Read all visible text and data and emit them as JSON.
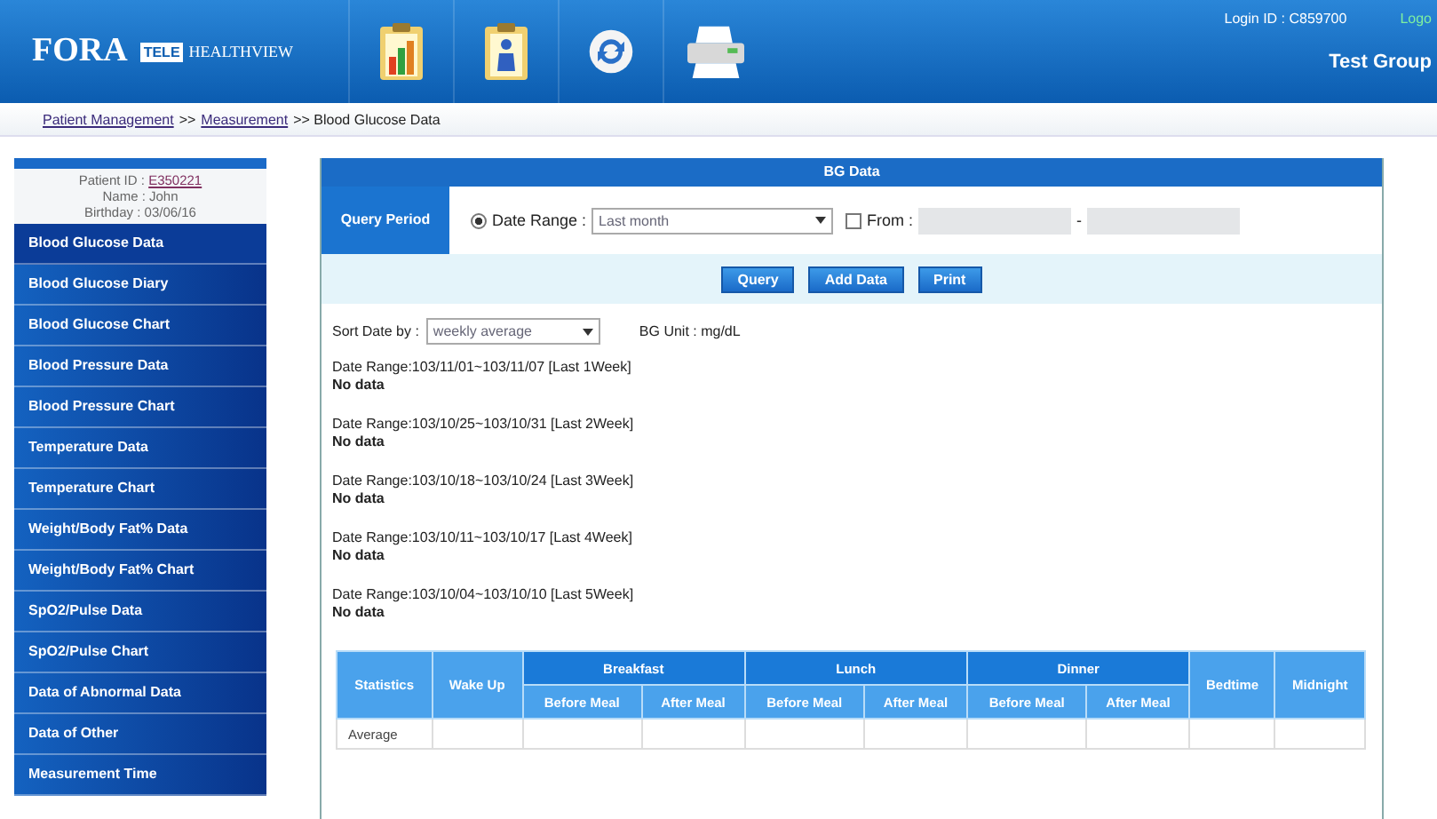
{
  "header": {
    "brand": "FORA",
    "badge": "TELE",
    "product": "HEALTHVIEW",
    "login": "Login ID : C859700",
    "logout": "Logo",
    "group": "Test Group"
  },
  "toolbar": [
    {
      "kind": "chart"
    },
    {
      "kind": "patient"
    },
    {
      "kind": "refresh"
    },
    {
      "kind": "print"
    }
  ],
  "breadcrumb": [
    "Patient Management",
    ">>",
    "Measurement",
    ">> Blood Glucose Data"
  ],
  "patient": {
    "id_label": "Patient ID :",
    "id": "E350221",
    "name": "Name : John",
    "birthday": "Birthday : 03/06/16"
  },
  "sidebar": {
    "items": [
      {
        "label": "Blood Glucose Data",
        "selected": true
      },
      {
        "label": "Blood Glucose Diary",
        "selected": false
      },
      {
        "label": "Blood Glucose Chart",
        "selected": false
      },
      {
        "label": "Blood Pressure Data",
        "selected": false
      },
      {
        "label": "Blood Pressure Chart",
        "selected": false
      },
      {
        "label": "Temperature Data",
        "selected": false
      },
      {
        "label": "Temperature Chart",
        "selected": false
      },
      {
        "label": "Weight/Body Fat% Data",
        "selected": false
      },
      {
        "label": "Weight/Body Fat% Chart",
        "selected": false
      },
      {
        "label": "SpO2/Pulse Data",
        "selected": false
      },
      {
        "label": "SpO2/Pulse Chart",
        "selected": false
      },
      {
        "label": "Data of Abnormal Data",
        "selected": false
      },
      {
        "label": "Data of Other",
        "selected": false
      },
      {
        "label": "Measurement Time",
        "selected": false
      }
    ]
  },
  "panel": {
    "title": "BG Data",
    "query_label": "Query Period",
    "date_range": {
      "label": "Date Range :",
      "selected": true,
      "value": "Last month"
    },
    "from": {
      "label": "From :",
      "checked": false,
      "separator": "-"
    },
    "buttons": [
      "Query",
      "Add Data",
      "Print"
    ],
    "sort": {
      "label": "Sort Date by :",
      "value": "weekly average"
    },
    "unit": "BG Unit : mg/dL",
    "weeks": [
      {
        "range": "Date Range:103/11/01~103/11/07 [Last 1Week]",
        "result": "No data"
      },
      {
        "range": "Date Range:103/10/25~103/10/31 [Last 2Week]",
        "result": "No data"
      },
      {
        "range": "Date Range:103/10/18~103/10/24 [Last 3Week]",
        "result": "No data"
      },
      {
        "range": "Date Range:103/10/11~103/10/17 [Last 4Week]",
        "result": "No data"
      },
      {
        "range": "Date Range:103/10/04~103/10/10 [Last 5Week]",
        "result": "No data"
      }
    ],
    "table": {
      "columns": [
        {
          "label": "Statistics"
        },
        {
          "label": "Wake Up"
        },
        {
          "label": "Breakfast",
          "children": [
            "Before Meal",
            "After Meal"
          ]
        },
        {
          "label": "Lunch",
          "children": [
            "Before Meal",
            "After Meal"
          ]
        },
        {
          "label": "Dinner",
          "children": [
            "Before Meal",
            "After Meal"
          ]
        },
        {
          "label": "Bedtime"
        },
        {
          "label": "Midnight"
        }
      ],
      "rows": [
        [
          "Average"
        ]
      ]
    }
  }
}
